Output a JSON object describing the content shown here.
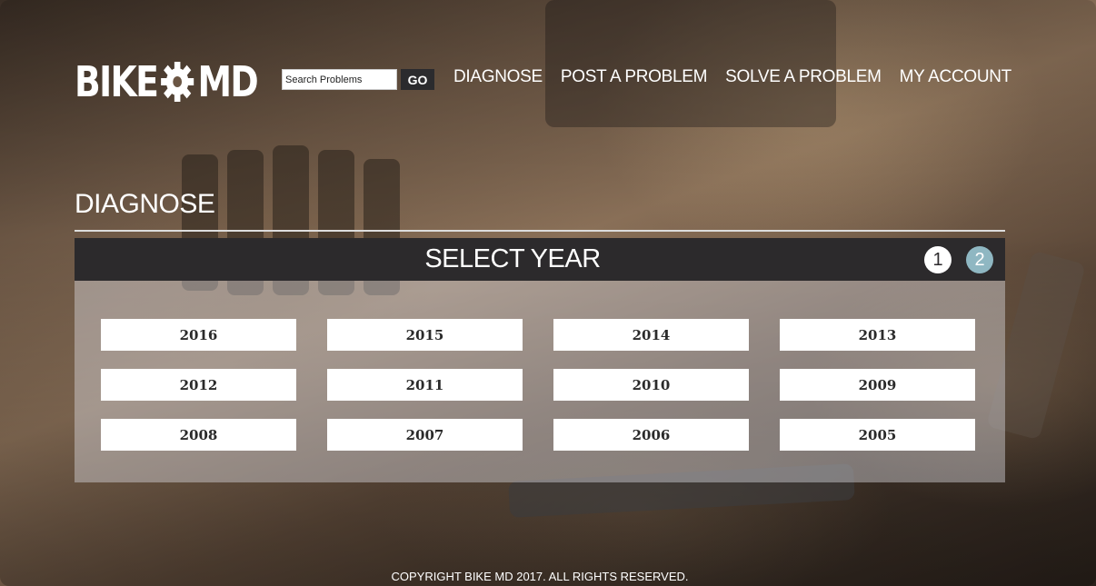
{
  "header": {
    "logo_left": "BIKE",
    "logo_right": "MD",
    "search": {
      "placeholder": "Search Problems",
      "button_label": "GO"
    },
    "nav": [
      "DIAGNOSE",
      "POST A PROBLEM",
      "SOLVE A PROBLEM",
      "MY ACCOUNT"
    ]
  },
  "main": {
    "page_title": "DIAGNOSE",
    "panel_title": "SELECT YEAR",
    "steps": [
      "1",
      "2"
    ],
    "years": [
      "2016",
      "2015",
      "2014",
      "2013",
      "2012",
      "2011",
      "2010",
      "2009",
      "2008",
      "2007",
      "2006",
      "2005"
    ]
  },
  "footer": {
    "text": "COPYRIGHT BIKE MD 2017. ALL RIGHTS RESERVED."
  },
  "colors": {
    "header_bar": "#2c2a2c",
    "step_next": "#8fb7c2",
    "button_bg": "#ffffff"
  },
  "icons": {
    "logo_gear": "gear-icon"
  }
}
